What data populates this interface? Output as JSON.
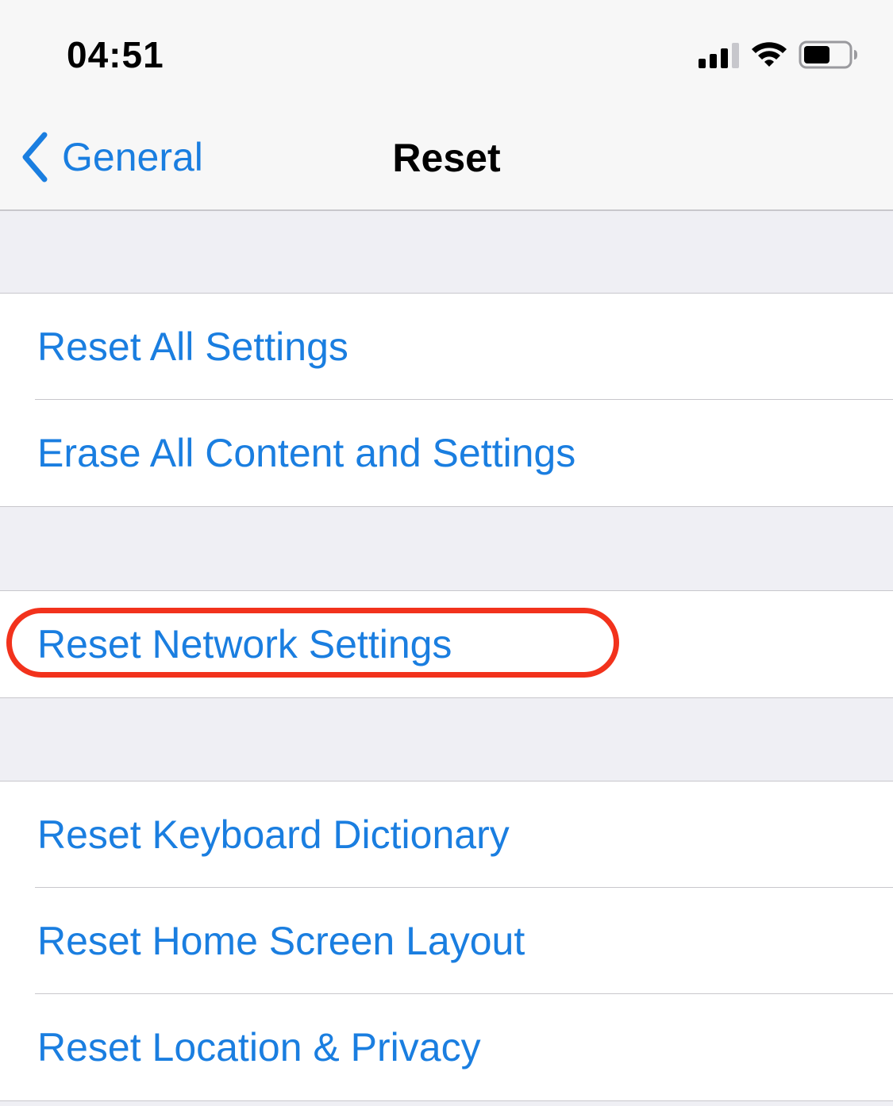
{
  "status_bar": {
    "time": "04:51",
    "icons": [
      "signal-icon",
      "wifi-icon",
      "battery-icon"
    ]
  },
  "nav": {
    "back_label": "General",
    "title": "Reset"
  },
  "sections": [
    {
      "items": [
        {
          "label": "Reset All Settings"
        },
        {
          "label": "Erase All Content and Settings"
        }
      ]
    },
    {
      "items": [
        {
          "label": "Reset Network Settings",
          "highlighted": true
        }
      ]
    },
    {
      "items": [
        {
          "label": "Reset Keyboard Dictionary"
        },
        {
          "label": "Reset Home Screen Layout"
        },
        {
          "label": "Reset Location & Privacy"
        }
      ]
    }
  ],
  "colors": {
    "accent": "#1a7ee0",
    "highlight": "#f2321c",
    "background": "#efeff4"
  }
}
